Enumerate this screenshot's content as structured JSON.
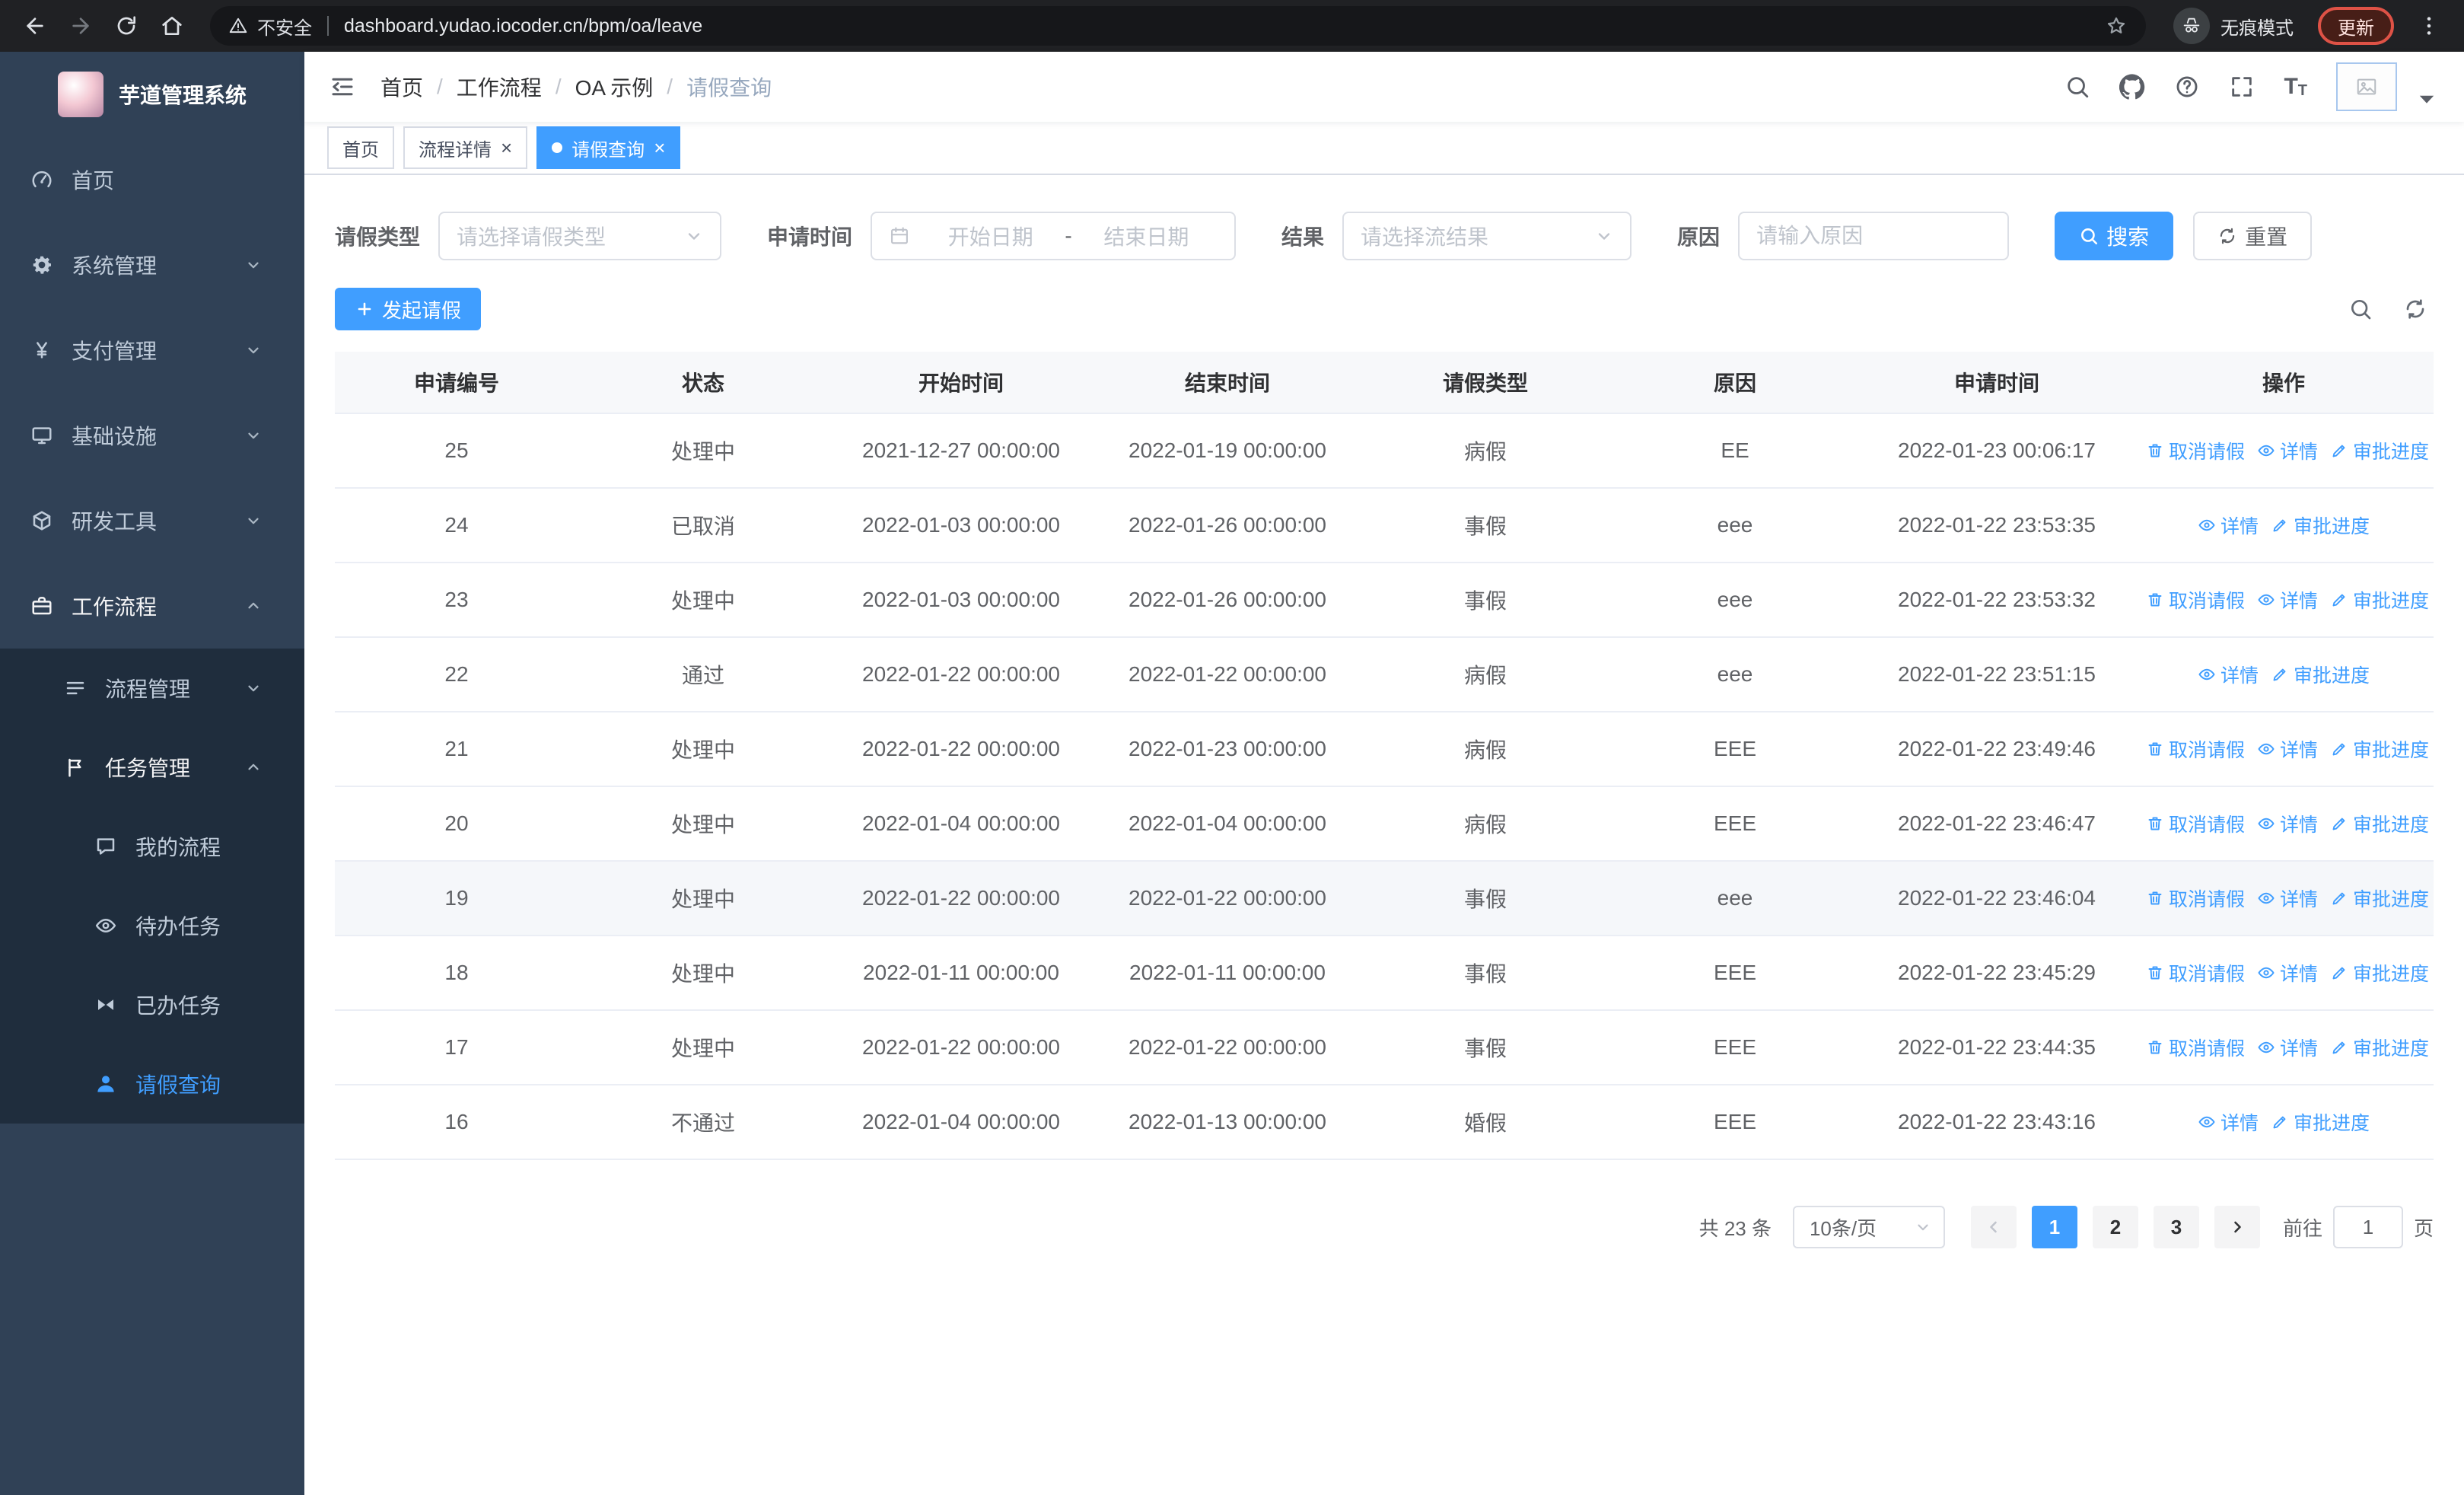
{
  "colors": {
    "primary": "#409eff",
    "sidebar_bg": "#304156",
    "sidebar_submenu_bg": "#1f2d3d",
    "active_tab_bg": "#409eff"
  },
  "browser": {
    "security_label": "不安全",
    "url": "dashboard.yudao.iocoder.cn/bpm/oa/leave",
    "incognito_label": "无痕模式",
    "update_label": "更新"
  },
  "sidebar": {
    "logo_title": "芋道管理系统",
    "menu": [
      {
        "name": "home",
        "label": "首页",
        "icon": "dashboard-icon",
        "level": 1
      },
      {
        "name": "system-management",
        "label": "系统管理",
        "icon": "gear-icon",
        "level": 1,
        "chevron": "down"
      },
      {
        "name": "payment-management",
        "label": "支付管理",
        "icon": "yen-icon",
        "level": 1,
        "chevron": "down"
      },
      {
        "name": "infrastructure",
        "label": "基础设施",
        "icon": "monitor-icon",
        "level": 1,
        "chevron": "down"
      },
      {
        "name": "dev-tools",
        "label": "研发工具",
        "icon": "cube-icon",
        "level": 1,
        "chevron": "down"
      },
      {
        "name": "workflow",
        "label": "工作流程",
        "icon": "briefcase-icon",
        "level": 1,
        "chevron": "up",
        "expanded": true
      },
      {
        "name": "process-management",
        "label": "流程管理",
        "icon": "list-icon",
        "level": 2,
        "chevron": "down"
      },
      {
        "name": "task-management",
        "label": "任务管理",
        "icon": "flag-icon",
        "level": 2,
        "chevron": "up",
        "expanded": true
      },
      {
        "name": "my-processes",
        "label": "我的流程",
        "icon": "chat-icon",
        "level": 3
      },
      {
        "name": "todo-tasks",
        "label": "待办任务",
        "icon": "eye-icon",
        "level": 3
      },
      {
        "name": "done-tasks",
        "label": "已办任务",
        "icon": "bowtie-icon",
        "level": 3
      },
      {
        "name": "leave-query",
        "label": "请假查询",
        "icon": "user-icon",
        "level": 3,
        "active": true
      }
    ]
  },
  "header": {
    "breadcrumb": [
      "首页",
      "工作流程",
      "OA 示例",
      "请假查询"
    ]
  },
  "tabs": [
    {
      "label": "首页",
      "closable": false,
      "active": false
    },
    {
      "label": "流程详情",
      "closable": true,
      "active": false
    },
    {
      "label": "请假查询",
      "closable": true,
      "active": true
    }
  ],
  "filters": {
    "leave_type": {
      "label": "请假类型",
      "placeholder": "请选择请假类型"
    },
    "apply_time": {
      "label": "申请时间",
      "start_placeholder": "开始日期",
      "separator": "-",
      "end_placeholder": "结束日期"
    },
    "result": {
      "label": "结果",
      "placeholder": "请选择流结果"
    },
    "reason": {
      "label": "原因",
      "placeholder": "请输入原因"
    },
    "search_label": "搜索",
    "reset_label": "重置"
  },
  "toolbar": {
    "create_label": "发起请假"
  },
  "table": {
    "columns": [
      "申请编号",
      "状态",
      "开始时间",
      "结束时间",
      "请假类型",
      "原因",
      "申请时间",
      "操作"
    ],
    "action_defs": {
      "cancel": {
        "name": "cancel-leave",
        "label": "取消请假",
        "icon": "delete-icon"
      },
      "detail": {
        "name": "detail",
        "label": "详情",
        "icon": "eye-icon"
      },
      "progress": {
        "name": "approval-progress",
        "label": "审批进度",
        "icon": "edit-icon"
      }
    },
    "rows": [
      {
        "id": "25",
        "status": "处理中",
        "start_time": "2021-12-27 00:00:00",
        "end_time": "2022-01-19 00:00:00",
        "leave_type": "病假",
        "reason": "EE",
        "apply_time": "2022-01-23 00:06:17",
        "actions": [
          "cancel",
          "detail",
          "progress"
        ]
      },
      {
        "id": "24",
        "status": "已取消",
        "start_time": "2022-01-03 00:00:00",
        "end_time": "2022-01-26 00:00:00",
        "leave_type": "事假",
        "reason": "eee",
        "apply_time": "2022-01-22 23:53:35",
        "actions": [
          "detail",
          "progress"
        ]
      },
      {
        "id": "23",
        "status": "处理中",
        "start_time": "2022-01-03 00:00:00",
        "end_time": "2022-01-26 00:00:00",
        "leave_type": "事假",
        "reason": "eee",
        "apply_time": "2022-01-22 23:53:32",
        "actions": [
          "cancel",
          "detail",
          "progress"
        ]
      },
      {
        "id": "22",
        "status": "通过",
        "start_time": "2022-01-22 00:00:00",
        "end_time": "2022-01-22 00:00:00",
        "leave_type": "病假",
        "reason": "eee",
        "apply_time": "2022-01-22 23:51:15",
        "actions": [
          "detail",
          "progress"
        ]
      },
      {
        "id": "21",
        "status": "处理中",
        "start_time": "2022-01-22 00:00:00",
        "end_time": "2022-01-23 00:00:00",
        "leave_type": "病假",
        "reason": "EEE",
        "apply_time": "2022-01-22 23:49:46",
        "actions": [
          "cancel",
          "detail",
          "progress"
        ]
      },
      {
        "id": "20",
        "status": "处理中",
        "start_time": "2022-01-04 00:00:00",
        "end_time": "2022-01-04 00:00:00",
        "leave_type": "病假",
        "reason": "EEE",
        "apply_time": "2022-01-22 23:46:47",
        "actions": [
          "cancel",
          "detail",
          "progress"
        ]
      },
      {
        "id": "19",
        "status": "处理中",
        "start_time": "2022-01-22 00:00:00",
        "end_time": "2022-01-22 00:00:00",
        "leave_type": "事假",
        "reason": "eee",
        "apply_time": "2022-01-22 23:46:04",
        "actions": [
          "cancel",
          "detail",
          "progress"
        ],
        "highlighted": true
      },
      {
        "id": "18",
        "status": "处理中",
        "start_time": "2022-01-11 00:00:00",
        "end_time": "2022-01-11 00:00:00",
        "leave_type": "事假",
        "reason": "EEE",
        "apply_time": "2022-01-22 23:45:29",
        "actions": [
          "cancel",
          "detail",
          "progress"
        ]
      },
      {
        "id": "17",
        "status": "处理中",
        "start_time": "2022-01-22 00:00:00",
        "end_time": "2022-01-22 00:00:00",
        "leave_type": "事假",
        "reason": "EEE",
        "apply_time": "2022-01-22 23:44:35",
        "actions": [
          "cancel",
          "detail",
          "progress"
        ]
      },
      {
        "id": "16",
        "status": "不通过",
        "start_time": "2022-01-04 00:00:00",
        "end_time": "2022-01-13 00:00:00",
        "leave_type": "婚假",
        "reason": "EEE",
        "apply_time": "2022-01-22 23:43:16",
        "actions": [
          "detail",
          "progress"
        ]
      }
    ]
  },
  "pagination": {
    "total_label": "共 23 条",
    "page_size_value": "10条/页",
    "pages": [
      "1",
      "2",
      "3"
    ],
    "active_page": "1",
    "goto_label": "前往",
    "goto_value": "1",
    "page_unit": "页"
  }
}
